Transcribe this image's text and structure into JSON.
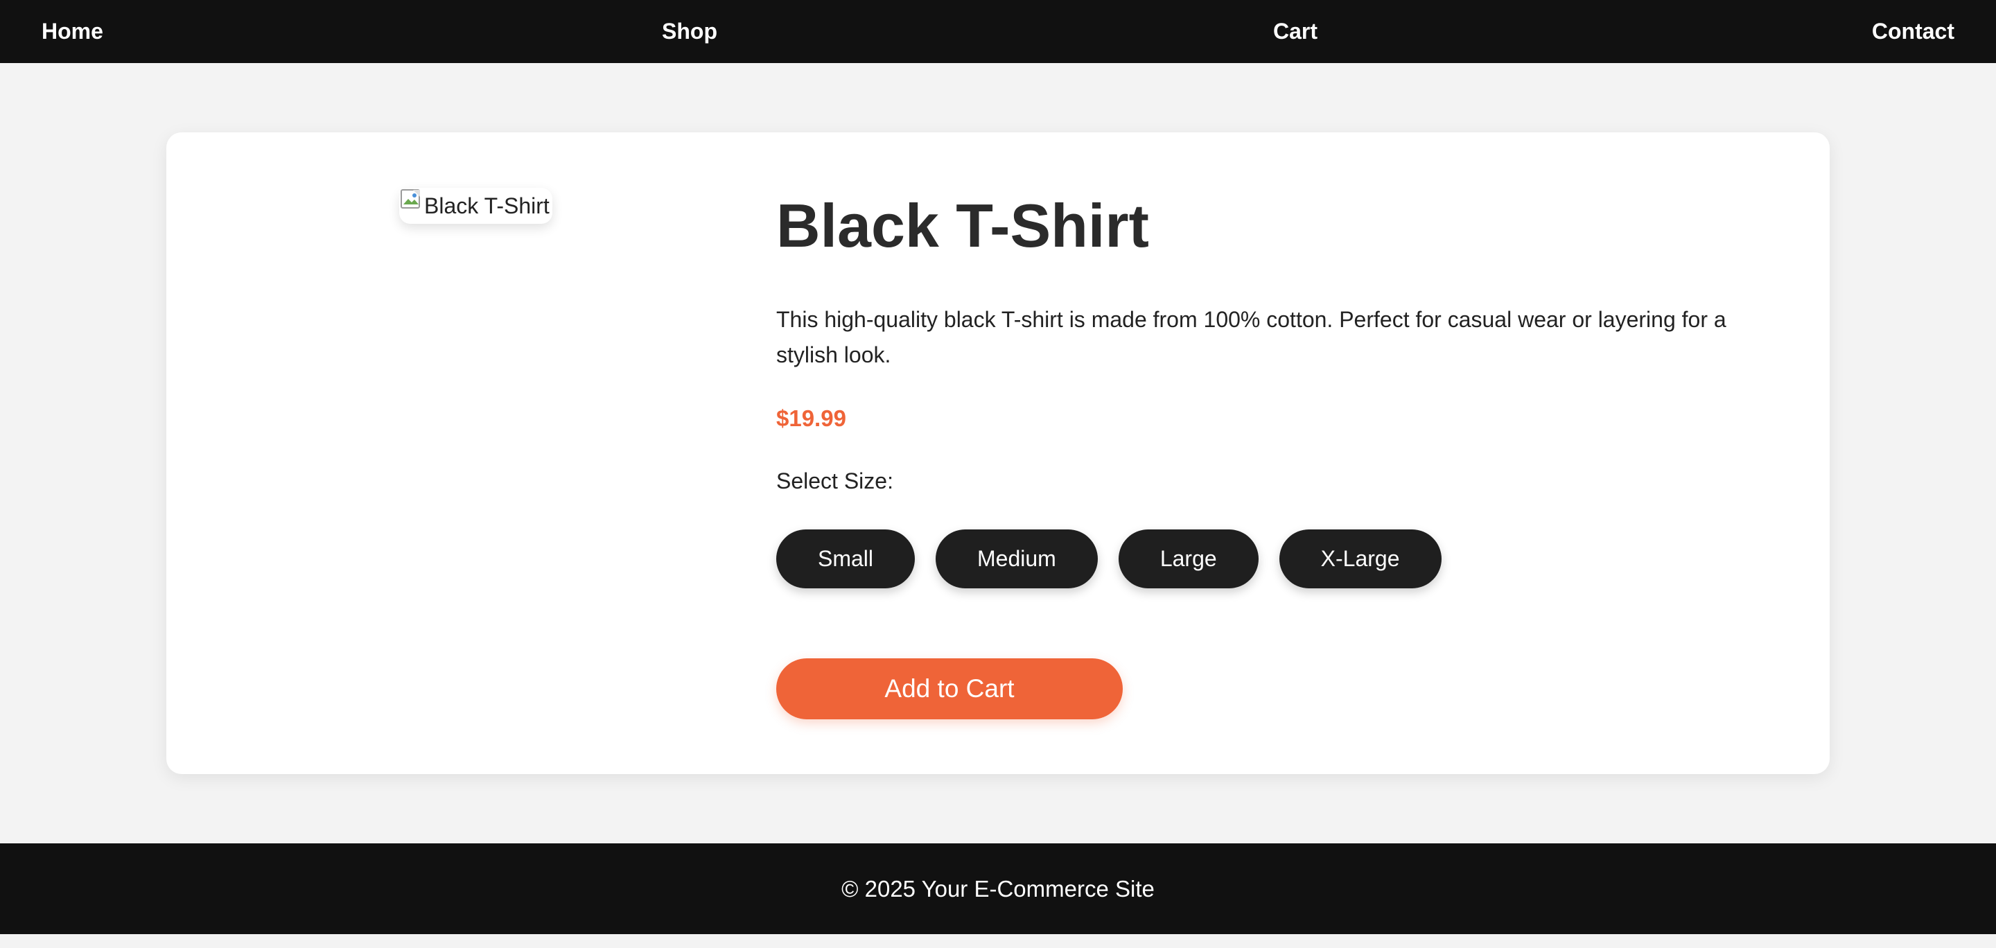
{
  "nav": {
    "home": "Home",
    "shop": "Shop",
    "cart": "Cart",
    "contact": "Contact"
  },
  "product": {
    "image_alt": "Black T-Shirt",
    "image_icon": "broken-image-icon",
    "title": "Black T-Shirt",
    "description": "This high-quality black T-shirt is made from 100% cotton. Perfect for casual wear or layering for a stylish look.",
    "price": "$19.99",
    "size_label": "Select Size:",
    "sizes": [
      "Small",
      "Medium",
      "Large",
      "X-Large"
    ],
    "add_to_cart": "Add to Cart"
  },
  "footer": {
    "text": "© 2025 Your E-Commerce Site"
  },
  "colors": {
    "nav_bg": "#111111",
    "page_bg": "#f3f3f3",
    "accent": "#ef6438",
    "size_button_bg": "#1f1f1f"
  }
}
